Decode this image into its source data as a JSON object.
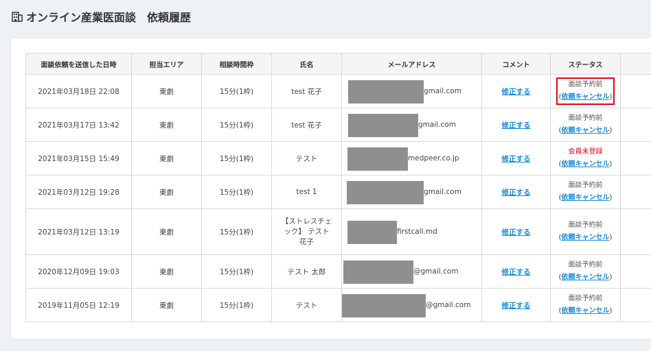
{
  "header": {
    "title": "オンライン産業医面談　依頼履歴",
    "icon": "building-icon"
  },
  "table": {
    "columns": [
      "面談依頼を送信した日時",
      "担当エリア",
      "相談時間枠",
      "氏名",
      "メールアドレス",
      "コメント",
      "ステータス"
    ],
    "edit_label": "修正する",
    "cancel_open": "(",
    "cancel_label": "依頼キャンセル",
    "cancel_close": ")",
    "rows": [
      {
        "datetime": "2021年03月18日 22:08",
        "area": "東劇",
        "slot": "15分(1枠)",
        "name": "test 花子",
        "email_suffix": "gmail.com",
        "status": "面談予約前",
        "status_color": "#555555"
      },
      {
        "datetime": "2021年03月17日 13:42",
        "area": "東劇",
        "slot": "15分(1枠)",
        "name": "test 花子",
        "email_suffix": "gmail.com",
        "status": "面談予約前",
        "status_color": "#555555"
      },
      {
        "datetime": "2021年03月15日 15:49",
        "area": "東劇",
        "slot": "15分(1枠)",
        "name": "テスト",
        "email_suffix": "medpeer.co.jp",
        "status": "会員未登録",
        "status_color": "#e60012"
      },
      {
        "datetime": "2021年03月12日 19:28",
        "area": "東劇",
        "slot": "15分(1枠)",
        "name": "test 1",
        "email_suffix": "gmail.com",
        "status": "面談予約前",
        "status_color": "#555555"
      },
      {
        "datetime": "2021年03月12日 13:19",
        "area": "東劇",
        "slot": "15分(1枠)",
        "name": "【ストレスチェック】 テスト花子",
        "email_suffix": "firstcall.md",
        "status": "面談予約前",
        "status_color": "#555555"
      },
      {
        "datetime": "2020年12月09日 19:03",
        "area": "東劇",
        "slot": "15分(1枠)",
        "name": "テスト 太郎",
        "email_suffix": "@gmail.com",
        "status": "面談予約前",
        "status_color": "#555555"
      },
      {
        "datetime": "2019年11月05日 12:19",
        "area": "東劇",
        "slot": "15分(1枠)",
        "name": "テスト",
        "email_suffix": "@gmail.com",
        "status": "面談予約前",
        "status_color": "#555555"
      }
    ]
  }
}
